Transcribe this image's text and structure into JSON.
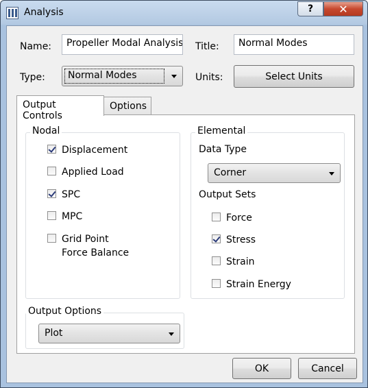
{
  "window": {
    "title": "Analysis",
    "help_glyph": "?",
    "close_glyph": "✕"
  },
  "form": {
    "name_label": "Name:",
    "name_value": "Propeller Modal Analysis",
    "title_label": "Title:",
    "title_value": "Normal Modes",
    "type_label": "Type:",
    "type_value": "Normal Modes",
    "units_label": "Units:",
    "select_units_label": "Select Units"
  },
  "tabs": [
    {
      "label": "Output Controls",
      "active": true
    },
    {
      "label": "Options",
      "active": false
    }
  ],
  "nodal": {
    "title": "Nodal",
    "items": [
      {
        "label": "Displacement",
        "checked": true
      },
      {
        "label": "Applied Load",
        "checked": false
      },
      {
        "label": "SPC",
        "checked": true
      },
      {
        "label": "MPC",
        "checked": false
      },
      {
        "label": "Grid Point Force Balance",
        "checked": false
      }
    ]
  },
  "elemental": {
    "title": "Elemental",
    "data_type_label": "Data Type",
    "data_type_value": "Corner",
    "output_sets_label": "Output Sets",
    "items": [
      {
        "label": "Force",
        "checked": false
      },
      {
        "label": "Stress",
        "checked": true
      },
      {
        "label": "Strain",
        "checked": false
      },
      {
        "label": "Strain Energy",
        "checked": false
      }
    ]
  },
  "output_options": {
    "title": "Output Options",
    "value": "Plot"
  },
  "footer": {
    "ok_label": "OK",
    "cancel_label": "Cancel"
  }
}
